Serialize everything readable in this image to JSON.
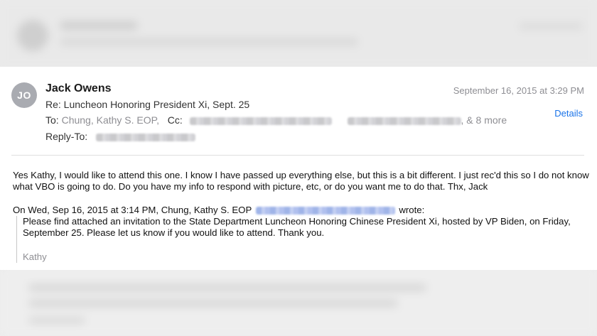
{
  "email": {
    "avatar_initials": "JO",
    "sender": "Jack Owens",
    "date": "September 16, 2015 at 3:29 PM",
    "subject": "Re: Luncheon Honoring President Xi, Sept. 25",
    "to_label": "To:",
    "to_value": "Chung, Kathy S. EOP,",
    "cc_label": "Cc:",
    "cc_more": ",  & 8 more",
    "details_label": "Details",
    "replyto_label": "Reply-To:",
    "body": "Yes Kathy, I would like to attend this one. I know I have passed up everything else, but this is a bit different. I just rec'd this so I do not know what VBO is going to do. Do you have my info to respond with picture, etc, or do you want me to do that. Thx, Jack",
    "quote_intro": "On Wed, Sep 16, 2015 at 3:14 PM, Chung, Kathy S. EOP",
    "quote_wrote": "wrote:",
    "quote_body": "Please find attached an invitation to the State Department Luncheon Honoring Chinese President Xi, hosted by VP Biden, on Friday, September 25.  Please let us know if you would like to attend.  Thank you.",
    "quote_signature": "Kathy"
  },
  "colors": {
    "link": "#1a73e8",
    "muted": "#8e8e93",
    "avatar": "#a9abb1"
  }
}
